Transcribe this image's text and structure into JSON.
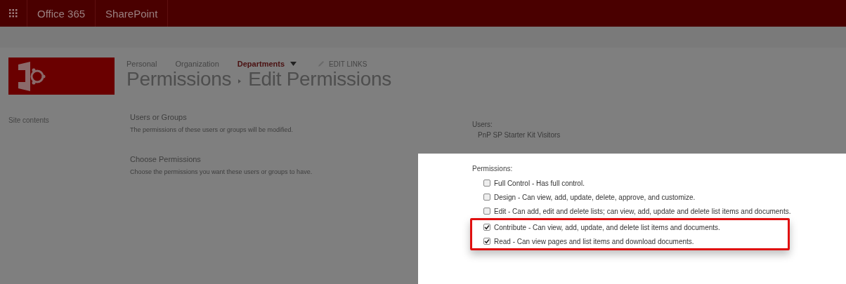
{
  "top_bar": {
    "items": [
      "Office 365",
      "SharePoint"
    ]
  },
  "nav": {
    "links": [
      {
        "label": "Personal",
        "selected": false
      },
      {
        "label": "Organization",
        "selected": false
      },
      {
        "label": "Departments",
        "selected": true
      }
    ],
    "edit_links": "EDIT LINKS"
  },
  "title": {
    "parent": "Permissions",
    "current": "Edit Permissions"
  },
  "sidebar": {
    "items": [
      "Site contents"
    ]
  },
  "sections": [
    {
      "heading": "Users or Groups",
      "description": "The permissions of these users or groups will be modified."
    },
    {
      "heading": "Choose Permissions",
      "description": "Choose the permissions you want these users or groups to have."
    }
  ],
  "users": {
    "label": "Users:",
    "value": "PnP SP Starter Kit Visitors"
  },
  "permissions": {
    "label": "Permissions:",
    "items": [
      {
        "label": "Full Control - Has full control.",
        "checked": false,
        "highlighted": false
      },
      {
        "label": "Design - Can view, add, update, delete, approve, and customize.",
        "checked": false,
        "highlighted": false
      },
      {
        "label": "Edit - Can add, edit and delete lists; can view, add, update and delete list items and documents.",
        "checked": false,
        "highlighted": false
      },
      {
        "label": "Contribute - Can view, add, update, and delete list items and documents.",
        "checked": true,
        "highlighted": true
      },
      {
        "label": "Read - Can view pages and list items and download documents.",
        "checked": true,
        "highlighted": true
      }
    ]
  }
}
